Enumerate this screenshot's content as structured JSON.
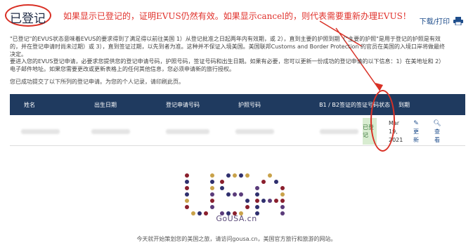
{
  "header": {
    "status_title": "已登记",
    "annotation": "如果显示已登记的，证明EVUS仍然有效。如果显示cancel的，则代表需要重新办理EVUS！",
    "download_print": "下载/打印"
  },
  "paragraphs": {
    "p1": "\"已登记\"的EVUS状态意味着EVUS的要求得到了满足得以前往美国 1）从登记批准之日起两年内有效期，或 2），直到主要的护照到期（\"主要的护照\"是用于登记的护照是有效的，并在登记申请时尚未过期）或 3），直到签证过期，以先到者为准。这种并不保证入境美国。美国联邦Customs and Border Protection 的官员在美国的入境口岸将做最终决定。",
    "p2": "要进入您的EVUS登记申请，必要求您提供您的登记申请号码，护照号码，签证号码和出生日期。如果有必要，您可以更新一份成功的登记申请的以下信息：1）在美地址和 2）电子邮件地址。如果您需要更改或更新表格上的任何其他信息，您必须申请新的旅行授权。",
    "p3": "您已成功提交了以下所列的登记申请。为您的个人记录，请印刷此页。"
  },
  "table": {
    "headers": {
      "name": "姓名",
      "dob": "出生日期",
      "app_number": "登记申请号码",
      "passport": "护照号码",
      "visa": "B1 / B2签证的签证号码",
      "status": "状态",
      "expiry": "到期"
    },
    "row": {
      "status": "已登记",
      "expiry_line1": "Mar",
      "expiry_line2": "19,",
      "expiry_line3": "2021",
      "update_label": "更新",
      "view_label": "查看"
    }
  },
  "logo": {
    "text": "USA",
    "caption": "GoUSA.cn",
    "colors": [
      "#2f2f6e",
      "#8a1f2d",
      "#c9a24a",
      "#5a3b7a"
    ]
  },
  "footer": {
    "note": "今天就开始策划您的美国之旅，请访问gousa.cn，美国官方旅行和旅游的网站。"
  },
  "colors": {
    "header_bg": "#1f3a5f",
    "annotation_red": "#e0312b",
    "badge_bg": "#d8ecd0"
  }
}
